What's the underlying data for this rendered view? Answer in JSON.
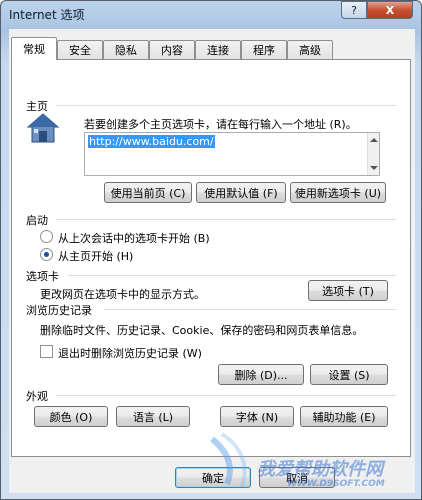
{
  "window": {
    "title": "Internet 选项",
    "help_label": "?",
    "close_label": "X"
  },
  "tabs": [
    "常规",
    "安全",
    "隐私",
    "内容",
    "连接",
    "程序",
    "高级"
  ],
  "home": {
    "heading": "主页",
    "description": "若要创建多个主页选项卡，请在每行输入一个地址 (R)。",
    "url": "http://www.baidu.com/",
    "buttons": [
      "使用当前页 (C)",
      "使用默认值 (F)",
      "使用新选项卡 (U)"
    ]
  },
  "startup": {
    "heading": "启动",
    "options": [
      "从上次会话中的选项卡开始 (B)",
      "从主页开始 (H)"
    ],
    "selected_index": 1
  },
  "tabs_section": {
    "heading": "选项卡",
    "description": "更改网页在选项卡中的显示方式。",
    "button": "选项卡 (T)"
  },
  "history": {
    "heading": "浏览历史记录",
    "description": "删除临时文件、历史记录、Cookie、保存的密码和网页表单信息。",
    "checkbox_label": "退出时删除浏览历史记录 (W)",
    "checked": false,
    "delete_button": "删除 (D)...",
    "settings_button": "设置 (S)"
  },
  "appearance": {
    "heading": "外观",
    "buttons": [
      "颜色 (O)",
      "语言 (L)",
      "字体 (N)",
      "辅助功能 (E)"
    ]
  },
  "footer": {
    "ok": "确定",
    "cancel": "取消"
  },
  "watermark": {
    "line1": "我爱帮助软件网",
    "line2": "WWW.D9SOFT.COM"
  }
}
